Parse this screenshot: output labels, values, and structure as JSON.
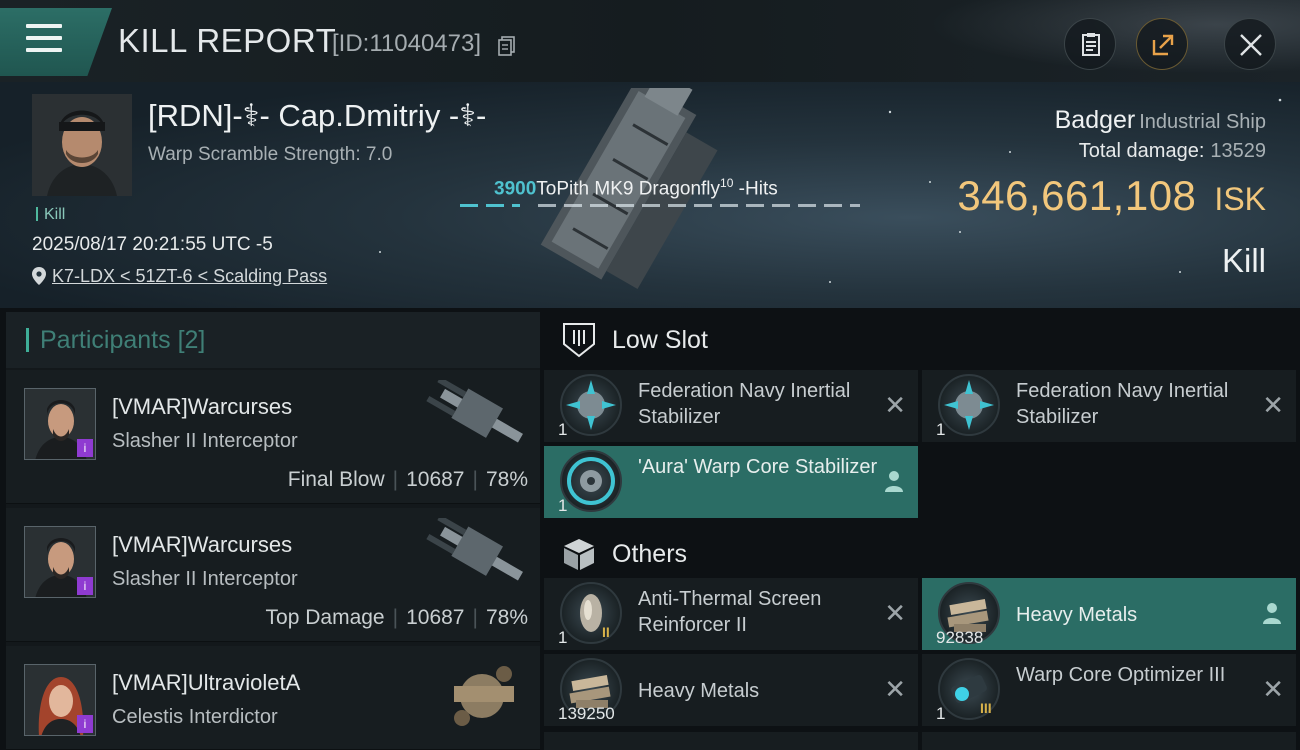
{
  "header": {
    "title": "KILL REPORT",
    "report_id": "[ID:11040473]",
    "icons": {
      "menu": "hamburger-icon",
      "copy": "copy-icon",
      "notes": "clipboard-icon",
      "share": "share-icon",
      "close": "close-icon"
    }
  },
  "victim": {
    "pilot_name": "[RDN]-⚕- Cap.Dmitriy -⚕-",
    "warp_scramble": "Warp Scramble Strength: 7.0",
    "kill_tag": "Kill",
    "datetime": "2025/08/17 20:21:55 UTC -5",
    "location": "K7-LDX < 51ZT-6 < Scalding Pass",
    "hits_number": "3900",
    "hits_text": "ToPith MK9 Dragonfly",
    "hits_sup": "10",
    "hits_suffix": " -Hits",
    "ship_name": "Badger",
    "ship_class": "Industrial Ship",
    "total_damage_label": "Total damage:",
    "total_damage_value": "13529",
    "isk_amount": "346,661,108",
    "isk_unit": "ISK",
    "result": "Kill"
  },
  "participants": {
    "title": "Participants",
    "count": "[2]",
    "items": [
      {
        "name": "[VMAR]Warcurses",
        "ship": "Slasher II Interceptor",
        "stat_label": "Final Blow",
        "damage": "10687",
        "percent": "78%",
        "badge": "i"
      },
      {
        "name": "[VMAR]Warcurses",
        "ship": "Slasher II Interceptor",
        "stat_label": "Top Damage",
        "damage": "10687",
        "percent": "78%",
        "badge": "i"
      },
      {
        "name": "[VMAR]UltravioletA",
        "ship": "Celestis Interdictor",
        "badge": "i"
      }
    ]
  },
  "sections": {
    "low_slot": "Low Slot",
    "others": "Others"
  },
  "low_slot_items": [
    {
      "name": "Federation Navy Inertial Stabilizer",
      "qty": "1",
      "status": "destroyed"
    },
    {
      "name": "Federation Navy Inertial Stabilizer",
      "qty": "1",
      "status": "destroyed"
    },
    {
      "name": "'Aura' Warp Core Stabilizer",
      "qty": "1",
      "status": "dropped"
    }
  ],
  "other_items": [
    {
      "name": "Anti-Thermal Screen Reinforcer II",
      "qty": "1",
      "meta": "II",
      "status": "destroyed"
    },
    {
      "name": "Heavy Metals",
      "qty": "92838",
      "status": "dropped"
    },
    {
      "name": "Heavy Metals",
      "qty": "139250",
      "status": "destroyed"
    },
    {
      "name": "Warp Core Optimizer III",
      "qty": "1",
      "meta": "III",
      "status": "destroyed"
    }
  ],
  "colors": {
    "accent": "#2b6d65",
    "isk": "#f2c77c",
    "hits": "#4fc2cf"
  },
  "symbols": {
    "destroyed": "✕"
  }
}
